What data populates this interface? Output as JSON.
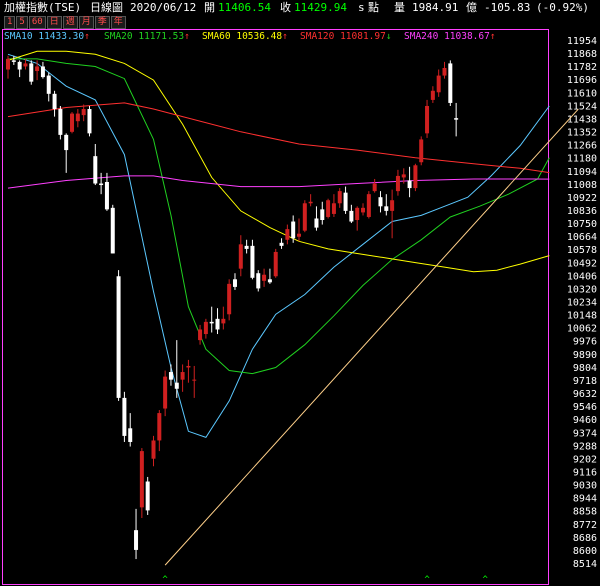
{
  "header": {
    "name": "加權指數(TSE)",
    "period": "日線圖",
    "date": "2020/06/12",
    "open_label": "開",
    "open_value": "11406.54",
    "close_label": "收",
    "close_value": "11429.94",
    "s_label": "s",
    "points_label": "點",
    "volume_label": "量",
    "volume_value": "1984.91",
    "volume_unit": "億",
    "change": "-105.83",
    "change_pct": "(-0.92%)"
  },
  "timeframes": [
    "1",
    "5",
    "60",
    "日",
    "週",
    "月",
    "季",
    "年"
  ],
  "legend": [
    {
      "label": "SMA10",
      "value": "11433.30",
      "arrow": "↑",
      "color": "#5bc8ff"
    },
    {
      "label": "SMA20",
      "value": "11171.53",
      "arrow": "↑",
      "color": "#20d020"
    },
    {
      "label": "SMA60",
      "value": "10536.48",
      "arrow": "↑",
      "color": "#ffff00"
    },
    {
      "label": "SMA120",
      "value": "11081.97",
      "arrow": "↓",
      "color": "#ff3030"
    },
    {
      "label": "SMA240",
      "value": "11038.67",
      "arrow": "↑",
      "color": "#ff40ff"
    }
  ],
  "colors": {
    "up": "#d02020",
    "down": "#ffffff",
    "frame": "#ff40ff",
    "trendline": "#ffd08a",
    "marker": "#00ff00"
  },
  "chart_data": {
    "type": "candlestick",
    "ylim": [
      8500,
      12000
    ],
    "y_ticks": [
      11954,
      11868,
      11782,
      11696,
      11610,
      11524,
      11438,
      11352,
      11266,
      11180,
      11094,
      11008,
      10922,
      10836,
      10750,
      10664,
      10578,
      10492,
      10406,
      10320,
      10234,
      10148,
      10062,
      9976,
      9890,
      9804,
      9718,
      9632,
      9546,
      9460,
      9374,
      9288,
      9202,
      9116,
      9030,
      8944,
      8858,
      8772,
      8686,
      8600,
      8514
    ],
    "candles": [
      [
        11760,
        11850,
        11700,
        11830
      ],
      [
        11820,
        11850,
        11790,
        11810
      ],
      [
        11810,
        11820,
        11710,
        11760
      ],
      [
        11780,
        11830,
        11760,
        11800
      ],
      [
        11800,
        11820,
        11660,
        11680
      ],
      [
        11750,
        11820,
        11690,
        11780
      ],
      [
        11780,
        11810,
        11700,
        11710
      ],
      [
        11720,
        11740,
        11550,
        11600
      ],
      [
        11600,
        11620,
        11450,
        11500
      ],
      [
        11500,
        11520,
        11300,
        11330
      ],
      [
        11330,
        11340,
        11080,
        11230
      ],
      [
        11350,
        11480,
        11340,
        11470
      ],
      [
        11420,
        11500,
        11380,
        11470
      ],
      [
        11460,
        11530,
        11420,
        11500
      ],
      [
        11500,
        11520,
        11320,
        11340
      ],
      [
        11190,
        11270,
        11000,
        11010
      ],
      [
        11010,
        11080,
        10940,
        11000
      ],
      [
        11020,
        11080,
        10830,
        10840
      ],
      [
        10850,
        10870,
        10550,
        10550
      ],
      [
        10400,
        10440,
        9580,
        9600
      ],
      [
        9600,
        9640,
        9310,
        9350
      ],
      [
        9400,
        9500,
        9280,
        9310
      ],
      [
        8730,
        8870,
        8540,
        8600
      ],
      [
        8880,
        9270,
        8810,
        9250
      ],
      [
        9050,
        9080,
        8830,
        8860
      ],
      [
        9200,
        9350,
        9150,
        9320
      ],
      [
        9320,
        9520,
        9250,
        9500
      ],
      [
        9530,
        9780,
        9480,
        9740
      ],
      [
        9770,
        9820,
        9680,
        9720
      ],
      [
        9700,
        9980,
        9600,
        9660
      ],
      [
        9720,
        9820,
        9640,
        9770
      ],
      [
        9800,
        9850,
        9700,
        9810
      ],
      [
        9720,
        9810,
        9600,
        9720
      ],
      [
        9980,
        10080,
        9950,
        10050
      ],
      [
        10020,
        10120,
        9990,
        10100
      ],
      [
        10100,
        10200,
        10030,
        10090
      ],
      [
        10120,
        10190,
        10020,
        10050
      ],
      [
        10090,
        10200,
        10050,
        10120
      ],
      [
        10150,
        10380,
        10110,
        10350
      ],
      [
        10380,
        10420,
        10310,
        10330
      ],
      [
        10450,
        10670,
        10400,
        10610
      ],
      [
        10600,
        10640,
        10550,
        10580
      ],
      [
        10600,
        10640,
        10380,
        10390
      ],
      [
        10420,
        10440,
        10300,
        10320
      ],
      [
        10370,
        10450,
        10330,
        10410
      ],
      [
        10380,
        10450,
        10350,
        10360
      ],
      [
        10400,
        10580,
        10390,
        10560
      ],
      [
        10620,
        10650,
        10580,
        10600
      ],
      [
        10640,
        10740,
        10610,
        10710
      ],
      [
        10760,
        10800,
        10620,
        10650
      ],
      [
        10660,
        10780,
        10630,
        10680
      ],
      [
        10700,
        10900,
        10690,
        10880
      ],
      [
        10880,
        10940,
        10860,
        10890
      ],
      [
        10780,
        10860,
        10700,
        10720
      ],
      [
        10840,
        10890,
        10740,
        10770
      ],
      [
        10790,
        10910,
        10780,
        10900
      ],
      [
        10810,
        10940,
        10790,
        10880
      ],
      [
        10880,
        10980,
        10850,
        10960
      ],
      [
        10950,
        10990,
        10810,
        10830
      ],
      [
        10830,
        10870,
        10750,
        10760
      ],
      [
        10770,
        10860,
        10700,
        10850
      ],
      [
        10820,
        10880,
        10800,
        10850
      ],
      [
        10790,
        10960,
        10780,
        10940
      ],
      [
        10960,
        11040,
        10950,
        11010
      ],
      [
        10920,
        10960,
        10820,
        10860
      ],
      [
        10860,
        10940,
        10800,
        10830
      ],
      [
        10830,
        10970,
        10650,
        10900
      ],
      [
        10960,
        11100,
        10930,
        11060
      ],
      [
        11050,
        11110,
        11010,
        11070
      ],
      [
        11030,
        11120,
        10920,
        10980
      ],
      [
        10980,
        11140,
        10960,
        11130
      ],
      [
        11150,
        11320,
        11130,
        11300
      ],
      [
        11340,
        11560,
        11310,
        11520
      ],
      [
        11560,
        11650,
        11540,
        11620
      ],
      [
        11610,
        11760,
        11580,
        11720
      ],
      [
        11720,
        11810,
        11700,
        11770
      ],
      [
        11800,
        11820,
        11520,
        11540
      ],
      [
        11440,
        11540,
        11320,
        11430
      ]
    ],
    "series": [
      {
        "name": "SMA10",
        "color": "#5bc8ff",
        "values": [
          [
            0,
            11860
          ],
          [
            5,
            11800
          ],
          [
            10,
            11650
          ],
          [
            15,
            11560
          ],
          [
            20,
            11200
          ],
          [
            25,
            10300
          ],
          [
            28,
            9800
          ],
          [
            31,
            9380
          ],
          [
            34,
            9340
          ],
          [
            38,
            9580
          ],
          [
            42,
            9920
          ],
          [
            46,
            10150
          ],
          [
            51,
            10280
          ],
          [
            56,
            10460
          ],
          [
            61,
            10610
          ],
          [
            66,
            10760
          ],
          [
            71,
            10800
          ],
          [
            75,
            10860
          ],
          [
            79,
            10920
          ],
          [
            83,
            11060
          ],
          [
            88,
            11260
          ],
          [
            93,
            11520
          ]
        ]
      },
      {
        "name": "SMA20",
        "color": "#20d020",
        "values": [
          [
            0,
            11830
          ],
          [
            5,
            11830
          ],
          [
            10,
            11800
          ],
          [
            15,
            11780
          ],
          [
            20,
            11700
          ],
          [
            25,
            11300
          ],
          [
            28,
            10800
          ],
          [
            31,
            10200
          ],
          [
            34,
            9920
          ],
          [
            38,
            9780
          ],
          [
            42,
            9760
          ],
          [
            46,
            9800
          ],
          [
            51,
            9950
          ],
          [
            56,
            10140
          ],
          [
            61,
            10340
          ],
          [
            66,
            10510
          ],
          [
            71,
            10640
          ],
          [
            76,
            10790
          ],
          [
            81,
            10860
          ],
          [
            86,
            10940
          ],
          [
            91,
            11040
          ],
          [
            93,
            11180
          ]
        ]
      },
      {
        "name": "SMA60",
        "color": "#ffff00",
        "values": [
          [
            0,
            11820
          ],
          [
            5,
            11880
          ],
          [
            10,
            11880
          ],
          [
            15,
            11860
          ],
          [
            20,
            11800
          ],
          [
            25,
            11690
          ],
          [
            30,
            11400
          ],
          [
            35,
            11050
          ],
          [
            40,
            10830
          ],
          [
            45,
            10720
          ],
          [
            50,
            10630
          ],
          [
            55,
            10580
          ],
          [
            60,
            10550
          ],
          [
            65,
            10520
          ],
          [
            70,
            10490
          ],
          [
            75,
            10460
          ],
          [
            80,
            10430
          ],
          [
            84,
            10440
          ],
          [
            88,
            10480
          ],
          [
            93,
            10536
          ]
        ]
      },
      {
        "name": "SMA120",
        "color": "#ff3030",
        "values": [
          [
            0,
            11450
          ],
          [
            10,
            11510
          ],
          [
            20,
            11540
          ],
          [
            25,
            11500
          ],
          [
            30,
            11450
          ],
          [
            40,
            11350
          ],
          [
            50,
            11270
          ],
          [
            60,
            11230
          ],
          [
            70,
            11180
          ],
          [
            80,
            11140
          ],
          [
            88,
            11110
          ],
          [
            93,
            11082
          ]
        ]
      },
      {
        "name": "SMA240",
        "color": "#ff40ff",
        "values": [
          [
            0,
            10980
          ],
          [
            10,
            11030
          ],
          [
            20,
            11060
          ],
          [
            25,
            11060
          ],
          [
            30,
            11030
          ],
          [
            40,
            10990
          ],
          [
            50,
            10990
          ],
          [
            60,
            11010
          ],
          [
            70,
            11030
          ],
          [
            80,
            11040
          ],
          [
            90,
            11040
          ],
          [
            93,
            11039
          ]
        ]
      }
    ],
    "trendline": [
      [
        27,
        8500
      ],
      [
        98,
        11500
      ]
    ],
    "bottom_markers": [
      [
        27,
        "^"
      ],
      [
        72,
        "^"
      ],
      [
        82,
        "^"
      ]
    ]
  }
}
